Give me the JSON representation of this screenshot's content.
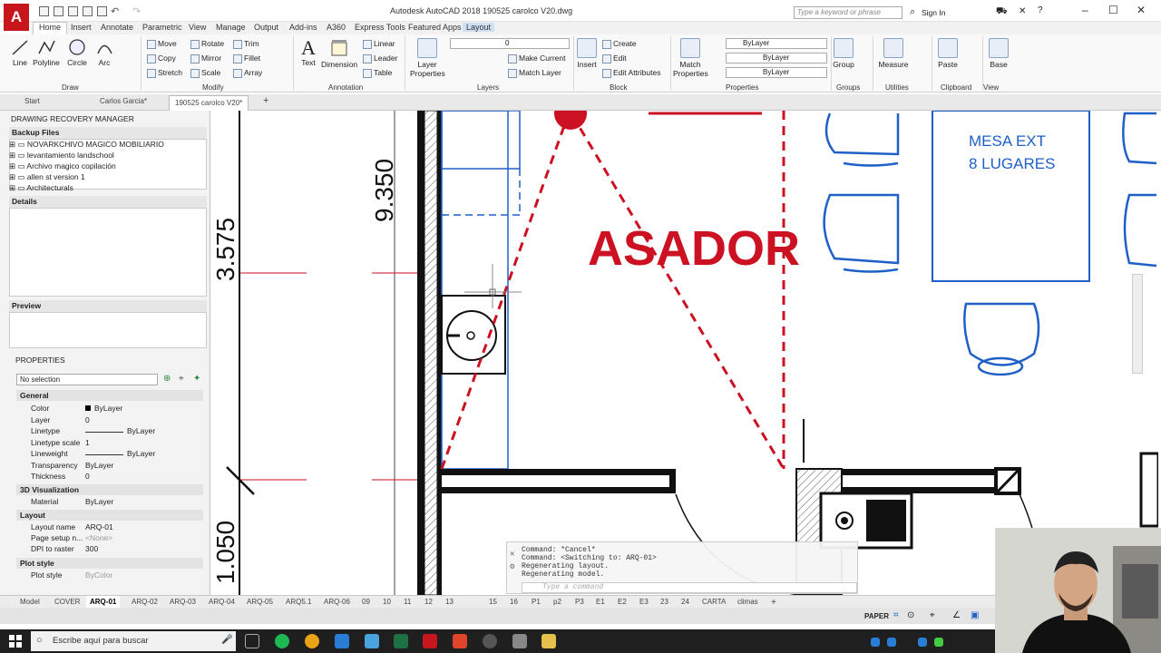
{
  "app": {
    "window_title": "Autodesk AutoCAD 2018    190525 carolco V20.dwg",
    "logo_letter": "A"
  },
  "search": {
    "placeholder": "Type a keyword or phrase",
    "signin": "Sign In"
  },
  "ribbon_tabs": [
    "Home",
    "Insert",
    "Annotate",
    "Parametric",
    "View",
    "Manage",
    "Output",
    "Add-ins",
    "A360",
    "Express Tools",
    "Featured Apps",
    "Layout"
  ],
  "ribbon": {
    "draw": {
      "title": "Draw",
      "line": "Line",
      "polyline": "Polyline",
      "circle": "Circle",
      "arc": "Arc"
    },
    "modify": {
      "title": "Modify",
      "move": "Move",
      "rotate": "Rotate",
      "trim": "Trim",
      "copy": "Copy",
      "mirror": "Mirror",
      "fillet": "Fillet",
      "stretch": "Stretch",
      "scale": "Scale",
      "array": "Array"
    },
    "annotation": {
      "title": "Annotation",
      "text": "Text",
      "dimension": "Dimension",
      "linear": "Linear",
      "leader": "Leader",
      "table": "Table"
    },
    "layers": {
      "title": "Layers",
      "layer_properties": "Layer Properties",
      "current_layer": "0",
      "make_current": "Make Current",
      "match_layer": "Match Layer"
    },
    "block": {
      "title": "Block",
      "insert": "Insert",
      "create": "Create",
      "edit": "Edit",
      "edit_attributes": "Edit Attributes"
    },
    "properties": {
      "title": "Properties",
      "match_properties": "Match Properties",
      "color": "ByLayer",
      "linetype": "ByLayer",
      "lineweight": "ByLayer"
    },
    "groups": {
      "title": "Groups",
      "group": "Group"
    },
    "utilities": {
      "title": "Utilities",
      "measure": "Measure"
    },
    "clipboard": {
      "title": "Clipboard",
      "paste": "Paste"
    },
    "view": {
      "title": "View",
      "base": "Base"
    }
  },
  "file_tabs": [
    "Start",
    "Carlos Garcia*",
    "190525 carolco V20*"
  ],
  "recovery": {
    "title": "DRAWING RECOVERY MANAGER",
    "backup_header": "Backup Files",
    "files": [
      "NOVARKCHIVO MAGICO MOBILIARIO",
      "levantamiento landschool",
      "Archivo magico copilación",
      "allen st version 1",
      "Architecturals"
    ],
    "details": "Details",
    "preview": "Preview"
  },
  "properties_palette": {
    "title": "PROPERTIES",
    "selection": "No selection",
    "general": "General",
    "rows": [
      {
        "k": "Color",
        "v": "ByLayer"
      },
      {
        "k": "Layer",
        "v": "0"
      },
      {
        "k": "Linetype",
        "v": "ByLayer"
      },
      {
        "k": "Linetype scale",
        "v": "1"
      },
      {
        "k": "Lineweight",
        "v": "ByLayer"
      },
      {
        "k": "Transparency",
        "v": "ByLayer"
      },
      {
        "k": "Thickness",
        "v": "0"
      }
    ],
    "viz3d": "3D Visualization",
    "material": {
      "k": "Material",
      "v": "ByLayer"
    },
    "layout": "Layout",
    "layout_rows": [
      {
        "k": "Layout name",
        "v": "ARQ-01"
      },
      {
        "k": "Page setup n...",
        "v": "<None>"
      },
      {
        "k": "DPI to raster",
        "v": "300"
      }
    ],
    "plot": "Plot style",
    "plot_rows": [
      {
        "k": "Plot style",
        "v": "ByColor"
      }
    ]
  },
  "drawing": {
    "dim1": "9.350",
    "dim2": "3.575",
    "dim3": "1.050",
    "asador": "ASADOR",
    "mesa_line1": "MESA EXT",
    "mesa_line2": "8 LUGARES",
    "colors": {
      "red": "#cc1122",
      "blue": "#1f5fc8",
      "black": "#111111"
    }
  },
  "command": {
    "lines": [
      "Command: *Cancel*",
      "Command:    <Switching to: ARQ-01>",
      "Regenerating layout.",
      "Regenerating model."
    ],
    "placeholder": "Type a command"
  },
  "layout_tabs": [
    "Model",
    "COVER",
    "ARQ-01",
    "ARQ-02",
    "ARQ-03",
    "ARQ-04",
    "ARQ-05",
    "ARQ5.1",
    "ARQ-06",
    "09",
    "10",
    "11",
    "12",
    "13",
    "15",
    "16",
    "P1",
    "p2",
    "P3",
    "E1",
    "E2",
    "E3",
    "23",
    "24",
    "CARTA",
    "climas"
  ],
  "status": {
    "paper": "PAPER"
  },
  "taskbar": {
    "search_placeholder": "Escribe aquí para buscar"
  }
}
